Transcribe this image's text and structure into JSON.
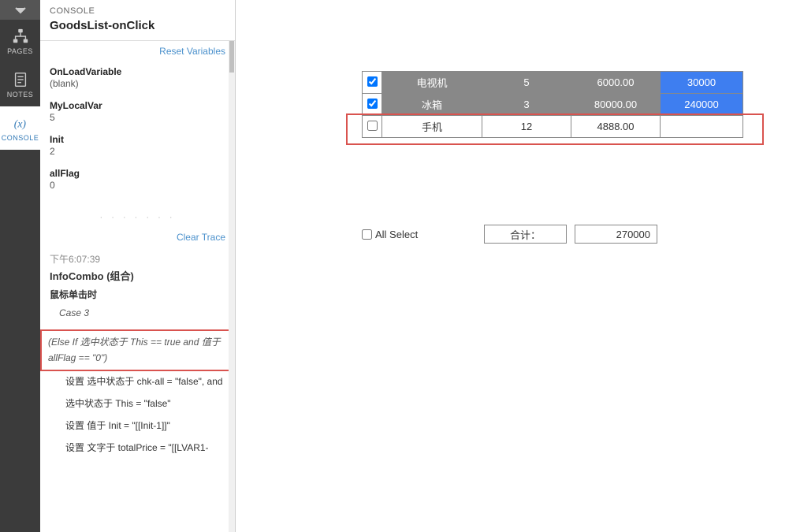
{
  "rail": {
    "pages": "PAGES",
    "notes": "NOTES",
    "console": "CONSOLE"
  },
  "console": {
    "label": "CONSOLE",
    "title": "GoodsList-onClick",
    "reset_variables": "Reset Variables",
    "vars": [
      {
        "name": "OnLoadVariable",
        "value": "(blank)"
      },
      {
        "name": "MyLocalVar",
        "value": "5"
      },
      {
        "name": "Init",
        "value": "2"
      },
      {
        "name": "allFlag",
        "value": "0"
      }
    ],
    "clear_trace": "Clear Trace",
    "trace": {
      "time": "下午6:07:39",
      "title": "InfoCombo (组合)",
      "subtitle": "鼠标单击时",
      "case_label": "Case 3",
      "condition": "(Else If 选中状态于 This == true and 值于 allFlag == \"0\")",
      "actions": [
        "设置 选中状态于 chk-all = \"false\", and",
        "选中状态于 This = \"false\"",
        "设置 值于 Init = \"[[Init-1]]\"",
        "设置 文字于 totalPrice = \"[[LVAR1-"
      ]
    }
  },
  "table": {
    "rows": [
      {
        "checked": true,
        "name": "电视机",
        "qty": "5",
        "price": "6000.00",
        "total": "30000",
        "selected": true
      },
      {
        "checked": true,
        "name": "冰箱",
        "qty": "3",
        "price": "80000.00",
        "total": "240000",
        "selected": true
      },
      {
        "checked": false,
        "name": "手机",
        "qty": "12",
        "price": "4888.00",
        "total": "",
        "selected": false
      }
    ]
  },
  "summary": {
    "all_select_label": "All Select",
    "all_select_checked": false,
    "sum_label": "合计：",
    "sum_value": "270000"
  }
}
